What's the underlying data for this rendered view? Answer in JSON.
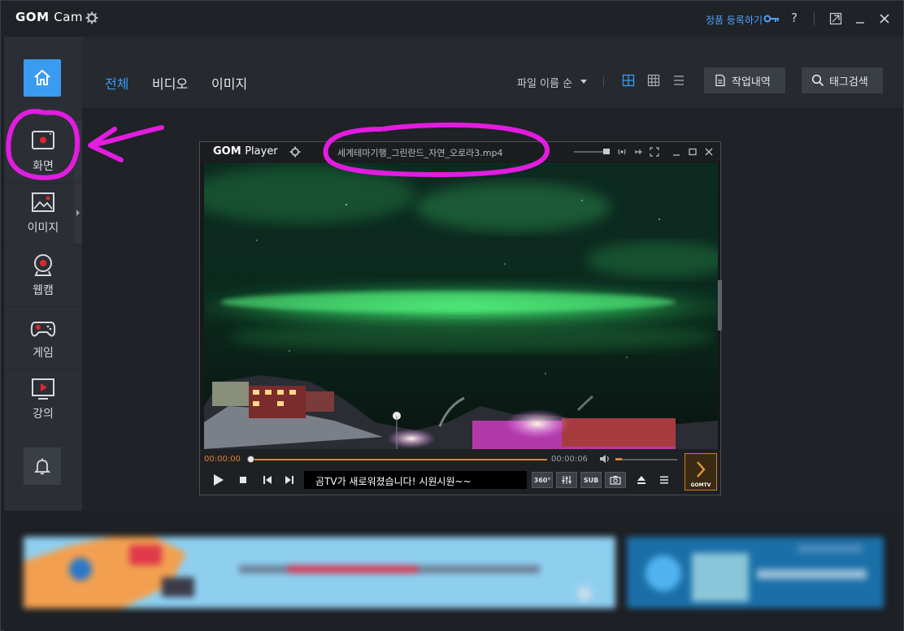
{
  "app": {
    "logo_bold": "GOM",
    "logo_light": "Cam",
    "register_label": "정품 등록하기",
    "help_label": "?"
  },
  "sidebar": {
    "items": [
      {
        "label": "화면",
        "icon": "screen-record-icon"
      },
      {
        "label": "이미지",
        "icon": "image-icon"
      },
      {
        "label": "웹캠",
        "icon": "webcam-icon"
      },
      {
        "label": "게임",
        "icon": "gamepad-icon"
      },
      {
        "label": "강의",
        "icon": "lecture-icon"
      }
    ]
  },
  "topbar": {
    "tabs": [
      {
        "label": "전체",
        "active": true
      },
      {
        "label": "비디오",
        "active": false
      },
      {
        "label": "이미지",
        "active": false
      }
    ],
    "sort_label": "파일 이름 순",
    "work_history_label": "작업내역",
    "tag_search_label": "태그검색"
  },
  "player": {
    "logo_bold": "GOM",
    "logo_light": "Player",
    "file_name": "세계테마기행_그린란드_자연_오로라3.mp4",
    "time_current": "00:00:00",
    "time_total": "00:00:06",
    "message": "곰TV가 새로워졌습니다! 시원시원~~",
    "sub_label": "SUB",
    "vr_label": "360°",
    "gomtv_label": "GOMTV"
  },
  "colors": {
    "accent": "#3a9bf0",
    "annotation": "#e21ce0",
    "seek": "#d7882e"
  }
}
